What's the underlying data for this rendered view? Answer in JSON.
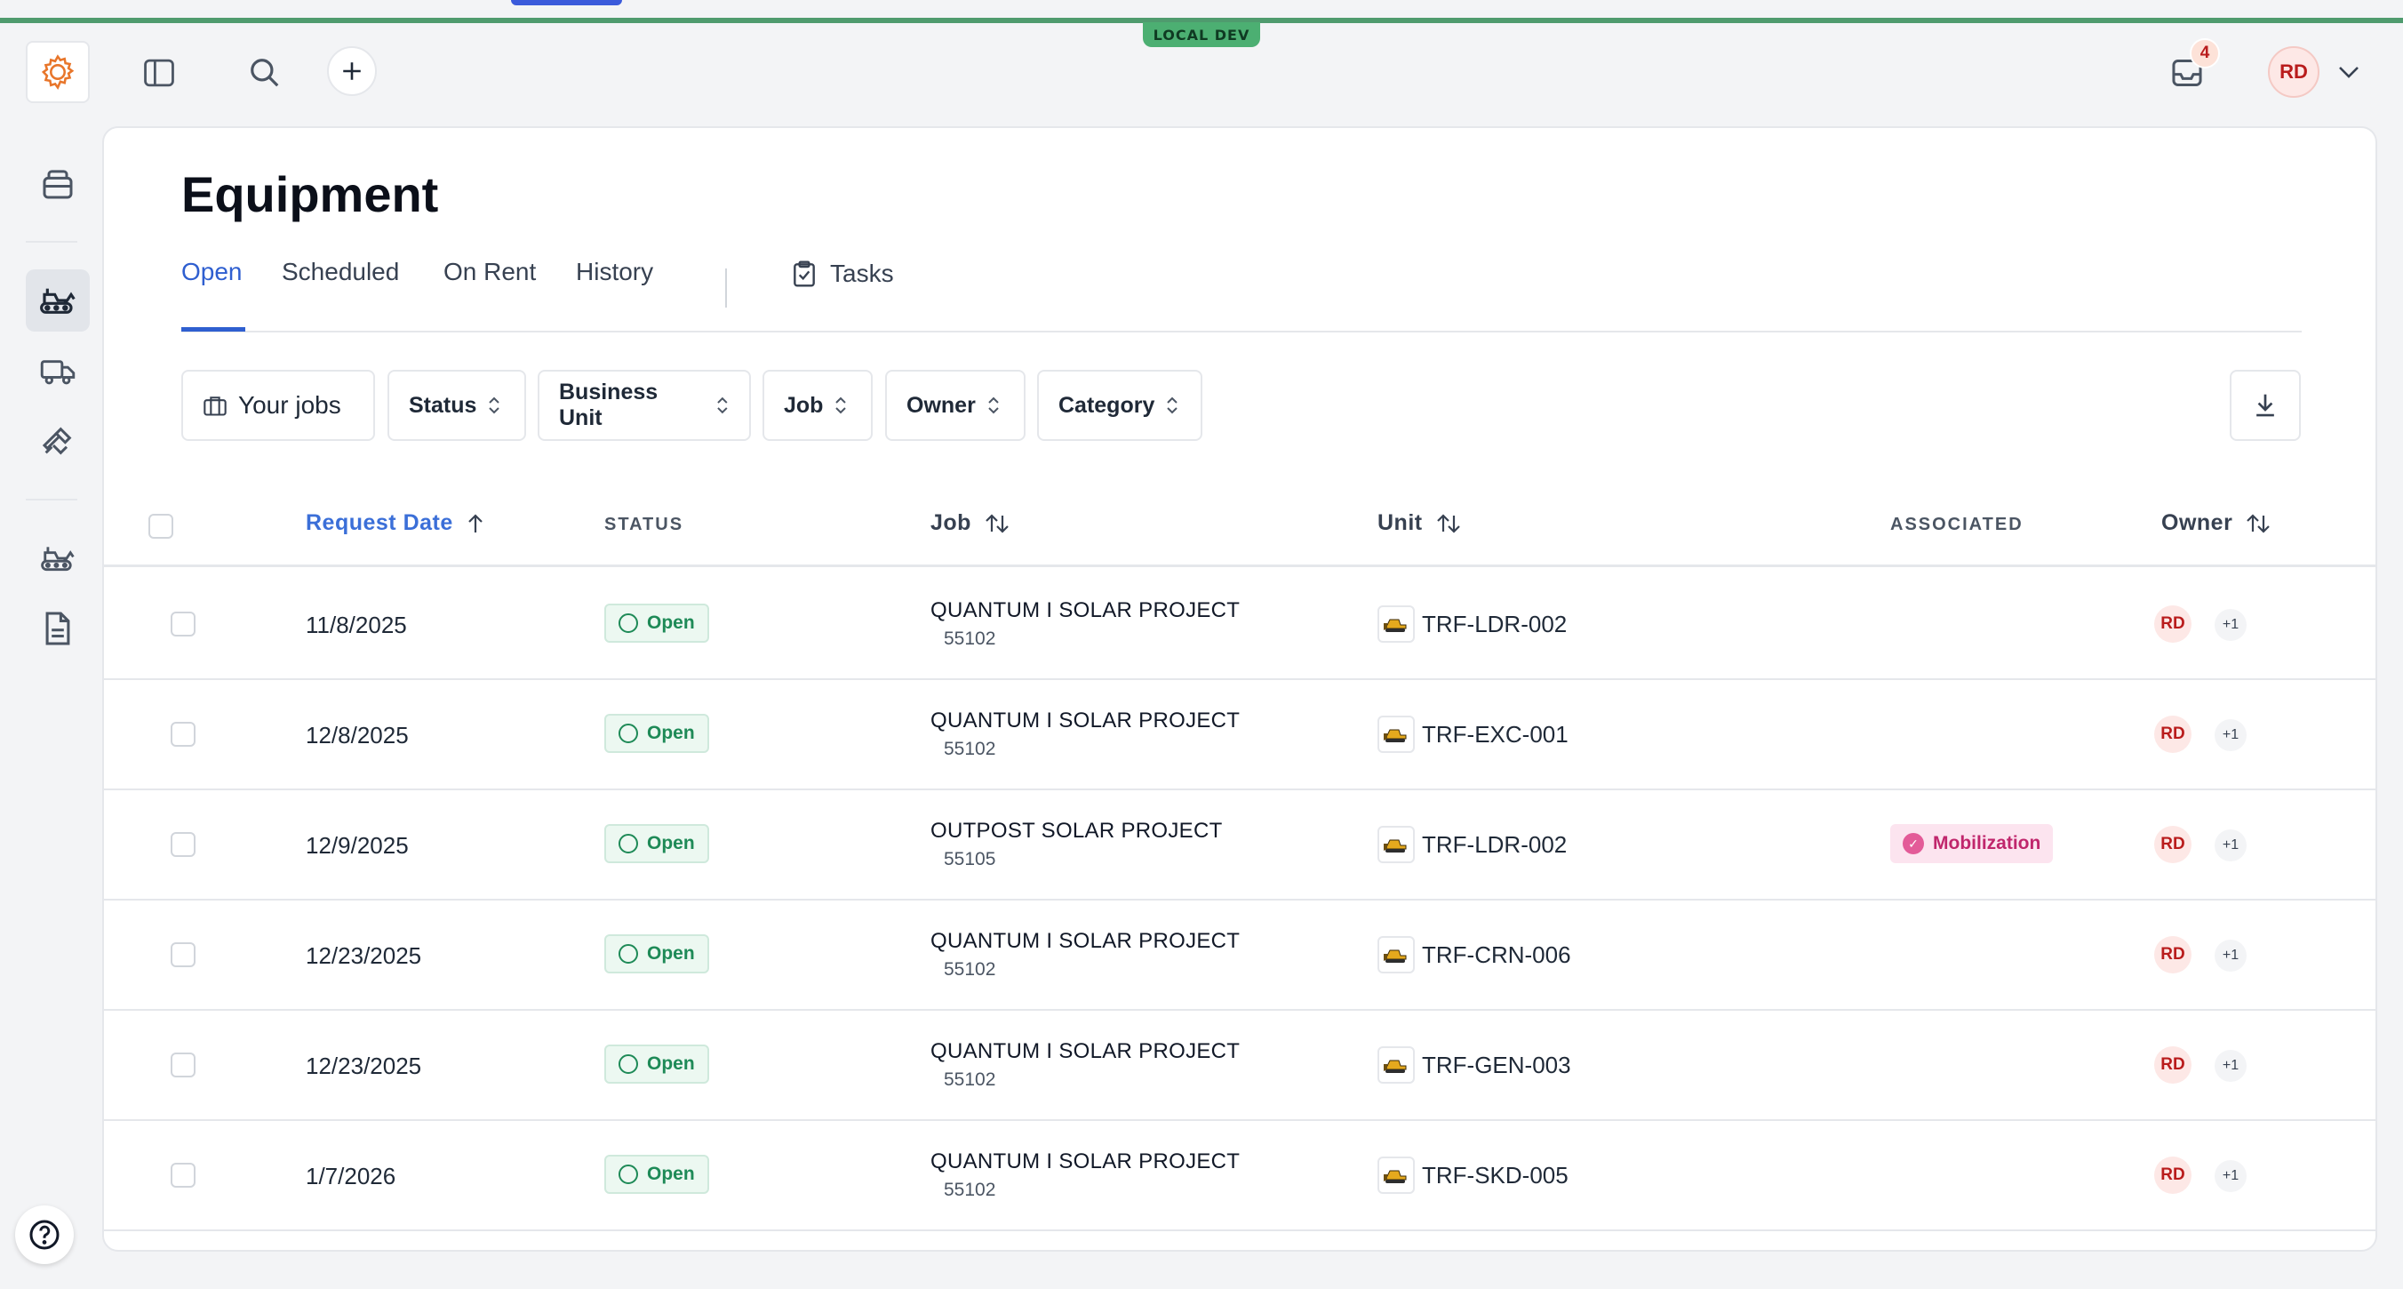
{
  "env_badge": "LOCAL DEV",
  "notifications": {
    "count": "4"
  },
  "user": {
    "initials": "RD"
  },
  "page": {
    "title": "Equipment"
  },
  "tabs": [
    {
      "label": "Open",
      "active": true
    },
    {
      "label": "Scheduled"
    },
    {
      "label": "On Rent"
    },
    {
      "label": "History"
    },
    {
      "label": "Tasks"
    }
  ],
  "filters": {
    "your_jobs": "Your jobs",
    "status": "Status",
    "business_unit": "Business Unit",
    "job": "Job",
    "owner": "Owner",
    "category": "Category"
  },
  "table": {
    "columns": {
      "request_date": "Request Date",
      "status": "STATUS",
      "job": "Job",
      "unit": "Unit",
      "associated": "ASSOCIATED",
      "owner": "Owner"
    },
    "rows": [
      {
        "date": "11/8/2025",
        "status": "Open",
        "job_name": "QUANTUM I SOLAR PROJECT",
        "job_number": "55102",
        "unit": "TRF-LDR-002",
        "associated": "",
        "owner": "RD",
        "owner_more": "+1"
      },
      {
        "date": "12/8/2025",
        "status": "Open",
        "job_name": "QUANTUM I SOLAR PROJECT",
        "job_number": "55102",
        "unit": "TRF-EXC-001",
        "associated": "",
        "owner": "RD",
        "owner_more": "+1"
      },
      {
        "date": "12/9/2025",
        "status": "Open",
        "job_name": "OUTPOST SOLAR PROJECT",
        "job_number": "55105",
        "unit": "TRF-LDR-002",
        "associated": "Mobilization",
        "owner": "RD",
        "owner_more": "+1"
      },
      {
        "date": "12/23/2025",
        "status": "Open",
        "job_name": "QUANTUM I SOLAR PROJECT",
        "job_number": "55102",
        "unit": "TRF-CRN-006",
        "associated": "",
        "owner": "RD",
        "owner_more": "+1"
      },
      {
        "date": "12/23/2025",
        "status": "Open",
        "job_name": "QUANTUM I SOLAR PROJECT",
        "job_number": "55102",
        "unit": "TRF-GEN-003",
        "associated": "",
        "owner": "RD",
        "owner_more": "+1"
      },
      {
        "date": "1/7/2026",
        "status": "Open",
        "job_name": "QUANTUM I SOLAR PROJECT",
        "job_number": "55102",
        "unit": "TRF-SKD-005",
        "associated": "",
        "owner": "RD",
        "owner_more": "+1"
      }
    ]
  },
  "colors": {
    "accent": "#2f5fd0",
    "env": "#4caf72",
    "status_open": "#1e8a57",
    "associated": "#c0266c",
    "brand": "#e8762b"
  },
  "icons": {
    "logo": "gear-logo-icon",
    "sidebar_toggle": "sidebar-toggle-icon",
    "search": "search-icon",
    "add": "plus-icon",
    "inbox": "inbox-icon",
    "user_menu": "chevron-down-icon",
    "help": "help-icon",
    "download": "download-icon",
    "nav": [
      "inventory-icon",
      "equipment-icon",
      "truck-icon",
      "tools-icon",
      "equipment-list-icon",
      "document-icon"
    ]
  }
}
